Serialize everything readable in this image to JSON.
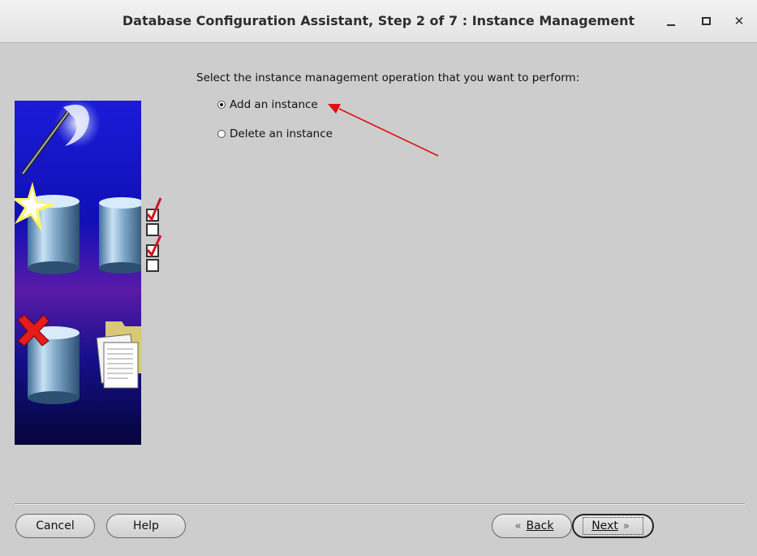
{
  "window": {
    "title": "Database Configuration Assistant, Step 2 of 7 : Instance Management"
  },
  "main": {
    "prompt": "Select the instance management operation that you want to perform:",
    "options": [
      {
        "label": "Add an instance",
        "selected": true
      },
      {
        "label": "Delete an instance",
        "selected": false
      }
    ]
  },
  "buttons": {
    "cancel": "Cancel",
    "help": "Help",
    "back": "Back",
    "next": "Next"
  },
  "colors": {
    "annotation_arrow": "#e01010",
    "panel_background": "#cdcdcd"
  }
}
